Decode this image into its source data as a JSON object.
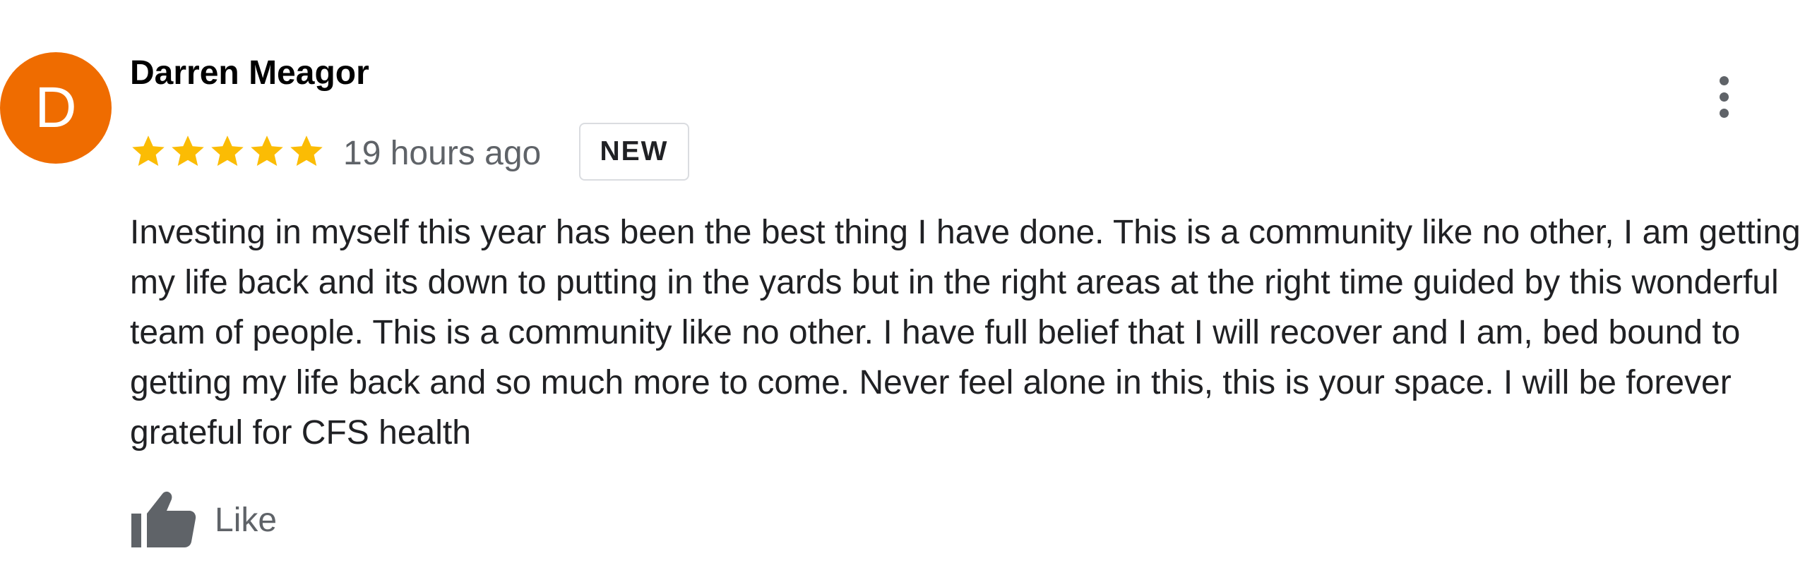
{
  "review": {
    "avatar_letter": "D",
    "avatar_color": "#ef6c00",
    "reviewer_name": "Darren Meagor",
    "rating": 5,
    "rating_max": 5,
    "star_color": "#fbbc04",
    "timestamp": "19 hours ago",
    "badge_label": "NEW",
    "text": "Investing in myself this year has been the best thing I have done. This is a community like no other, I am getting my life back and its down to putting in the yards but in the right areas at the right time guided by this wonderful team of people. This is a community like no other. I have full belief that I will recover and I am, bed bound to getting my life back and so much more to come. Never feel alone in this, this is your space. I will be forever grateful for CFS health",
    "menu_icon": "more-vert-icon",
    "like_icon": "thumbs-up-icon",
    "like_label": "Like"
  }
}
